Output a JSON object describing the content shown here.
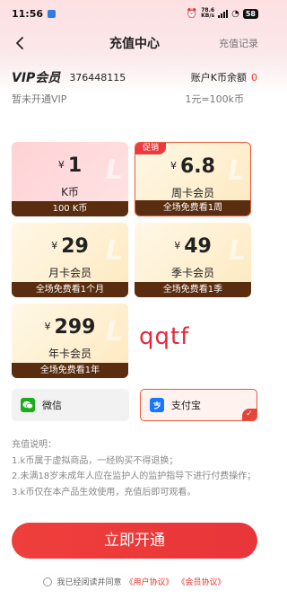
{
  "status": {
    "time": "11:56",
    "speed_top": "78.6",
    "speed_bottom": "KB/s",
    "network": "4G",
    "battery": "58"
  },
  "nav": {
    "title": "充值中心",
    "record": "充值记录"
  },
  "vip": {
    "title": "VIP会员",
    "id": "376448115",
    "balance_label": "账户K币余额",
    "balance_value": "0",
    "status": "暂未开通VIP",
    "rate": "1元=100k币"
  },
  "plans": [
    {
      "currency": "¥",
      "price": "1",
      "name": "K币",
      "footer": "100 K币",
      "promo": ""
    },
    {
      "currency": "¥",
      "price": "6.8",
      "name": "周卡会员",
      "footer": "全场免费看1周",
      "promo": "促销"
    },
    {
      "currency": "¥",
      "price": "29",
      "name": "月卡会员",
      "footer": "全场免费看1个月",
      "promo": ""
    },
    {
      "currency": "¥",
      "price": "49",
      "name": "季卡会员",
      "footer": "全场免费看1季",
      "promo": ""
    },
    {
      "currency": "¥",
      "price": "299",
      "name": "年卡会员",
      "footer": "全场免费看1年",
      "promo": ""
    }
  ],
  "watermark_text": "qqtf",
  "payment": {
    "wechat": {
      "icon": "wechat-icon",
      "label": "微信"
    },
    "alipay": {
      "icon": "alipay-icon",
      "label": "支付宝"
    },
    "selected": "alipay"
  },
  "notes": {
    "title": "充值说明：",
    "lines": [
      "1.k币属于虚拟商品，一经购买不得退换；",
      "2.未满18岁未成年人应在监护人的监护指导下进行付费操作；",
      "3.k币仅在本产品生效使用，充值后即可观看。"
    ]
  },
  "cta": {
    "label": "立即开通"
  },
  "agreement": {
    "text": "我已经阅读并同意",
    "link1": "《用户协议》",
    "link2": "《会员协议》"
  },
  "colors": {
    "accent": "#e8362b",
    "footer_brown": "#5a2d10",
    "promo_red": "#ec3a3f"
  }
}
